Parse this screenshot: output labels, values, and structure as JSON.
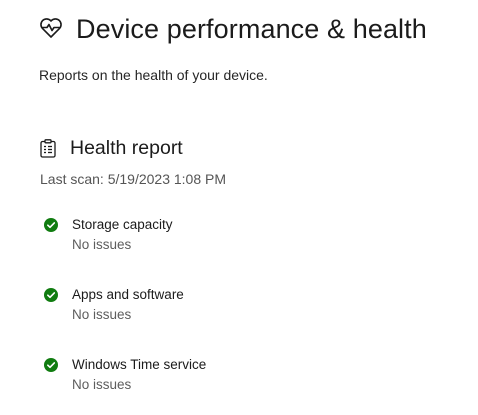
{
  "header": {
    "title": "Device performance & health",
    "icon": "heart-pulse-icon"
  },
  "subtitle": "Reports on the health of your device.",
  "health_report": {
    "title": "Health report",
    "icon": "clipboard-icon",
    "last_scan": "Last scan: 5/19/2023 1:08 PM",
    "items": [
      {
        "name": "Storage capacity",
        "status": "No issues",
        "icon": "check-circle-icon"
      },
      {
        "name": "Apps and software",
        "status": "No issues",
        "icon": "check-circle-icon"
      },
      {
        "name": "Windows Time service",
        "status": "No issues",
        "icon": "check-circle-icon"
      }
    ]
  },
  "colors": {
    "ok_green": "#107c10",
    "text_primary": "#1b1b1b",
    "text_secondary": "#5d5d5d"
  }
}
